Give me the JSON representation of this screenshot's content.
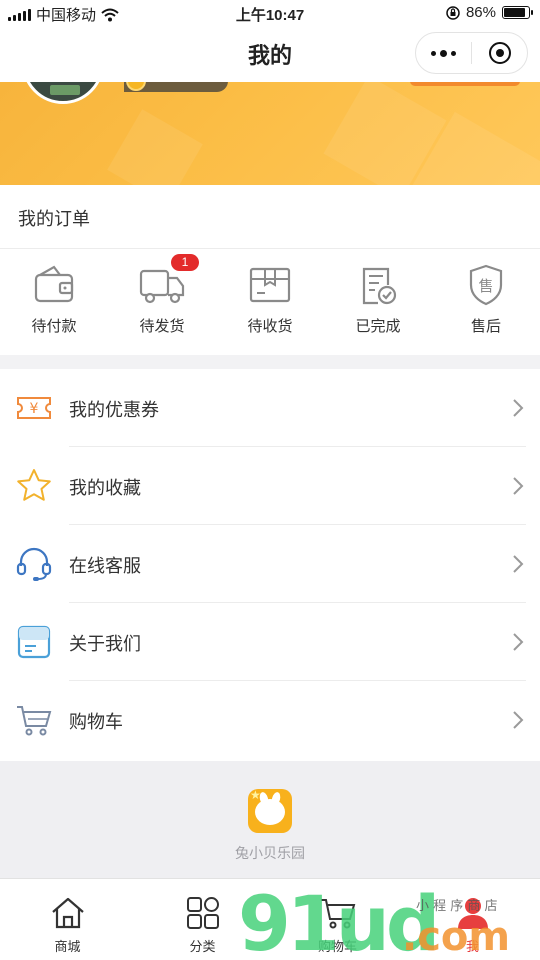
{
  "status_bar": {
    "carrier": "中国移动",
    "time": "上午10:47",
    "battery_percent": "86%",
    "battery_level": 0.86
  },
  "nav": {
    "title": "我的",
    "more_icon": "more-dots-icon",
    "close_icon": "target-circle-icon"
  },
  "orders": {
    "title": "我的订单",
    "items": [
      {
        "label": "待付款",
        "icon": "wallet-icon"
      },
      {
        "label": "待发货",
        "icon": "truck-icon",
        "badge": "1"
      },
      {
        "label": "待收货",
        "icon": "package-box-icon"
      },
      {
        "label": "已完成",
        "icon": "completed-document-icon"
      },
      {
        "label": "售后",
        "icon": "after-sale-shield-icon"
      }
    ]
  },
  "menu": [
    {
      "label": "我的优惠券",
      "icon": "coupon-icon"
    },
    {
      "label": "我的收藏",
      "icon": "star-icon"
    },
    {
      "label": "在线客服",
      "icon": "headset-icon"
    },
    {
      "label": "关于我们",
      "icon": "about-card-icon"
    },
    {
      "label": "购物车",
      "icon": "cart-icon"
    }
  ],
  "footer": {
    "brand_name": "兔小贝乐园",
    "logo_icon": "rabbit-logo-icon"
  },
  "tabbar": [
    {
      "label": "商城",
      "icon": "home-icon"
    },
    {
      "label": "分类",
      "icon": "category-grid-icon"
    },
    {
      "label": "购物车",
      "icon": "cart-icon"
    },
    {
      "label": "我",
      "icon": "user-icon",
      "active": true
    }
  ],
  "watermark": {
    "text": "91ud",
    "sub": ".com",
    "tagline": "小 程 序 商 店"
  },
  "colors": {
    "accent": "#e73f3f",
    "banner": "#fbbd45",
    "badge": "#e32b2b"
  }
}
